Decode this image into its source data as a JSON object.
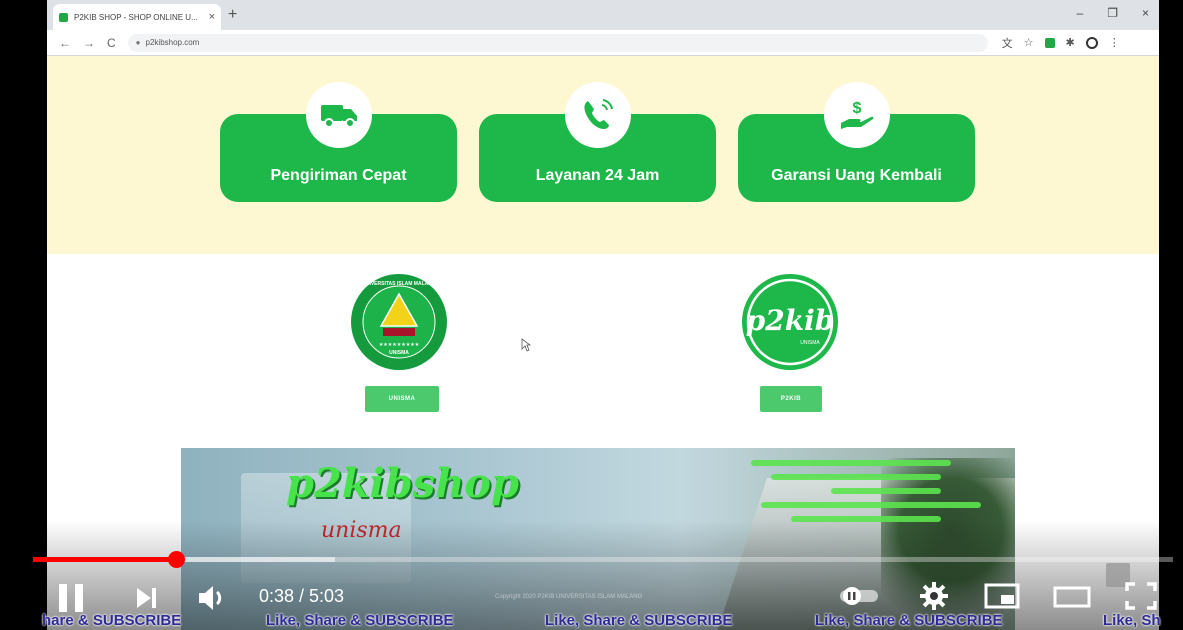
{
  "browser": {
    "tab_title": "P2KIB SHOP - SHOP ONLINE U...",
    "tab_close": "×",
    "new_tab": "+",
    "url": "p2kibshop.com",
    "window_controls": [
      "–",
      "❐",
      "×"
    ]
  },
  "features": [
    {
      "label": "Pengiriman Cepat",
      "icon": "truck-icon"
    },
    {
      "label": "Layanan 24 Jam",
      "icon": "phone-icon"
    },
    {
      "label": "Garansi Uang Kembali",
      "icon": "money-hand-icon"
    }
  ],
  "partners": [
    {
      "button": "UNISMA",
      "logo": "unisma-logo"
    },
    {
      "button": "P2KIB",
      "logo": "p2kib-logo"
    }
  ],
  "logo_text": {
    "unisma_ring": "UNIVERSITAS ISLAM MALANG",
    "unisma_base": "UNISMA",
    "p2kib_mark": "p2kib",
    "p2kib_small": "UNISMA"
  },
  "banner": {
    "script_title": "p2kibshop",
    "script_sub": "unisma"
  },
  "player": {
    "time": "0:38 / 5:03",
    "progress": 0.125,
    "buffered": 0.265,
    "copyright": "Copyright 2020 P2KIB UNIVERSITAS ISLAM MALANG",
    "subscribe_text": "Like, Share & SUBSCRIBE",
    "subscribe_fragments": [
      "hare & SUBSCRIBE",
      "Like, Share & SUBSCRIBE",
      "Like, Share & SUBSCRIBE",
      "Like, Share & SUBSCRIBE",
      "Like, Sh"
    ],
    "colors": {
      "played": "#ff0000",
      "brand_green": "#1eb74a"
    }
  }
}
